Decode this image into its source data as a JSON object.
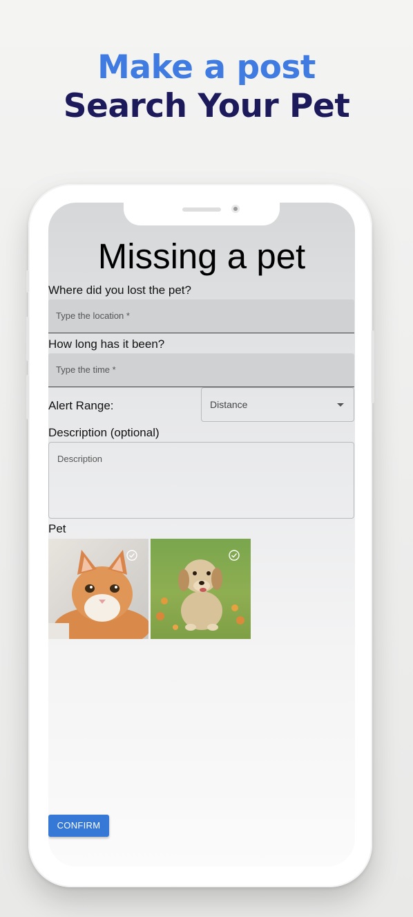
{
  "promo": {
    "line1": "Make a post",
    "line2": "Search Your Pet"
  },
  "form": {
    "title": "Missing a pet",
    "location_label": "Where did you lost the pet?",
    "location_placeholder": "Type the location *",
    "time_label": "How long has it been?",
    "time_placeholder": "Type the time *",
    "alert_label": "Alert Range:",
    "alert_select_value": "Distance",
    "description_label": "Description (optional)",
    "description_placeholder": "Description",
    "pet_label": "Pet",
    "pets": [
      {
        "name": "cat",
        "icon": "check-circle-icon"
      },
      {
        "name": "dog",
        "icon": "check-circle-icon"
      }
    ],
    "confirm_label": "CONFIRM"
  },
  "colors": {
    "accent_blue": "#3f7be0",
    "headline_navy": "#1c1a5a",
    "button_blue": "#3578d6"
  }
}
